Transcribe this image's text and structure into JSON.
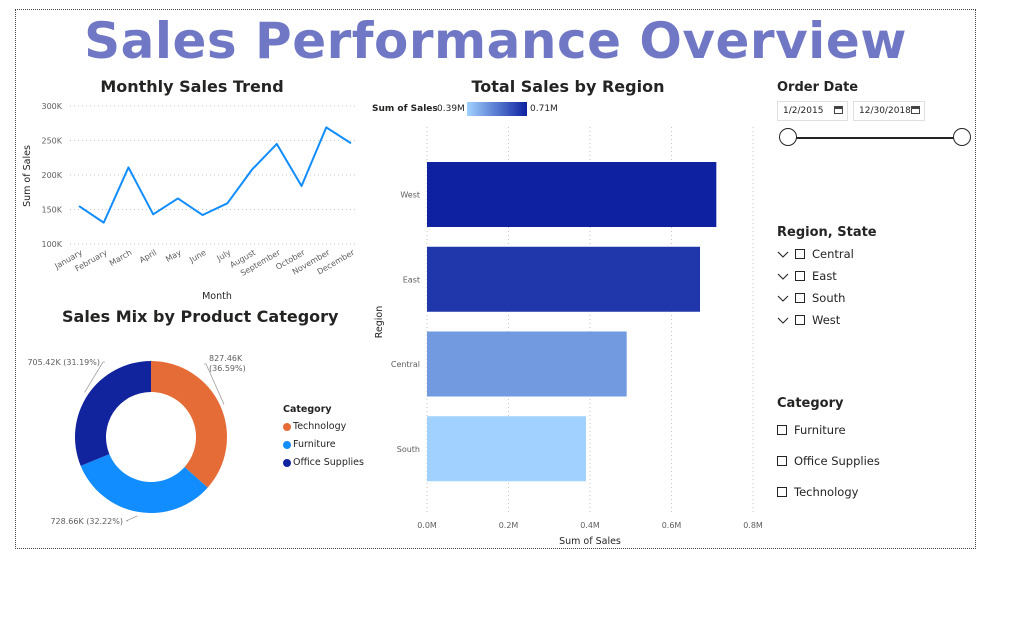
{
  "page": {
    "title": "Sales Performance Overview"
  },
  "monthly_trend": {
    "title": "Monthly Sales Trend"
  },
  "region_chart": {
    "title": "Total Sales by Region",
    "gradient_legend": {
      "label": "Sum of Sales",
      "min_label": "0.39M",
      "max_label": "0.71M"
    }
  },
  "product_mix": {
    "title": "Sales Mix by Product Category",
    "legend_title": "Category"
  },
  "slicers": {
    "order_date": {
      "title": "Order Date",
      "start": "1/2/2015",
      "end": "12/30/2018"
    },
    "region_state": {
      "title": "Region, State",
      "items": [
        "Central",
        "East",
        "South",
        "West"
      ]
    },
    "category": {
      "title": "Category",
      "items": [
        "Furniture",
        "Office Supplies",
        "Technology"
      ]
    }
  },
  "chart_data": [
    {
      "id": "monthly_trend",
      "type": "line",
      "title": "Monthly Sales Trend",
      "xlabel": "Month",
      "ylabel": "Sum of Sales",
      "categories": [
        "January",
        "February",
        "March",
        "April",
        "May",
        "June",
        "July",
        "August",
        "September",
        "October",
        "November",
        "December"
      ],
      "values": [
        155000,
        131000,
        211000,
        143000,
        166000,
        142000,
        159000,
        208000,
        245000,
        184000,
        269000,
        246000
      ],
      "yticks": [
        "100K",
        "150K",
        "200K",
        "250K",
        "300K"
      ],
      "ylim": [
        100000,
        300000
      ],
      "color": "#118dff",
      "grid": true
    },
    {
      "id": "region_sales",
      "type": "bar",
      "orientation": "horizontal",
      "title": "Total Sales by Region",
      "xlabel": "Sum of Sales",
      "ylabel": "Region",
      "categories": [
        "West",
        "East",
        "Central",
        "South"
      ],
      "values": [
        0.71,
        0.67,
        0.49,
        0.39
      ],
      "unit": "M",
      "xticks": [
        "0.0M",
        "0.2M",
        "0.4M",
        "0.6M",
        "0.8M"
      ],
      "xlim": [
        0,
        0.8
      ],
      "color_scale": [
        "#a0d1ff",
        "#0e21a0"
      ],
      "grid": true
    },
    {
      "id": "product_mix",
      "type": "pie",
      "donut": true,
      "title": "Sales Mix by Product Category",
      "legend_title": "Category",
      "legend_position": "right",
      "slices": [
        {
          "name": "Technology",
          "value": 827.46,
          "label": "827.46K",
          "pct_label": "(36.59%)",
          "color": "#e66c37"
        },
        {
          "name": "Furniture",
          "value": 728.66,
          "label": "728.66K (32.22%)",
          "pct_label": "",
          "color": "#118dff"
        },
        {
          "name": "Office Supplies",
          "value": 705.42,
          "label": "705.42K (31.19%)",
          "pct_label": "",
          "color": "#12239e"
        }
      ]
    }
  ]
}
